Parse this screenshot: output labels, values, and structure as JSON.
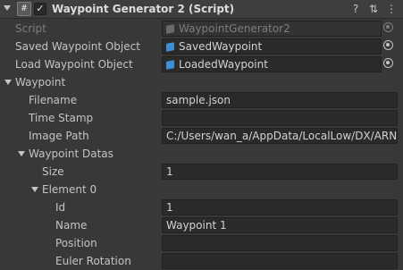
{
  "header": {
    "title": "Waypoint Generator 2 (Script)",
    "script_icon": "#",
    "enabled_mark": "✓",
    "help_icon": "?",
    "preset_icon": "⇅",
    "menu_icon": "⋮"
  },
  "fields": {
    "script": {
      "label": "Script",
      "value": "WaypointGenerator2"
    },
    "saved": {
      "label": "Saved Waypoint Object",
      "value": "SavedWaypoint"
    },
    "load": {
      "label": "Load Waypoint Object",
      "value": "LoadedWaypoint"
    },
    "waypoint": {
      "label": "Waypoint"
    },
    "filename": {
      "label": "Filename",
      "value": "sample.json"
    },
    "timestamp": {
      "label": "Time Stamp",
      "value": ""
    },
    "image_path": {
      "label": "Image Path",
      "value": "C:/Users/wan_a/AppData/LocalLow/DX/ARNav"
    },
    "datas": {
      "label": "Waypoint Datas"
    },
    "size": {
      "label": "Size",
      "value": "1"
    },
    "element0": {
      "label": "Element 0"
    },
    "id": {
      "label": "Id",
      "value": "1"
    },
    "name": {
      "label": "Name",
      "value": "Waypoint 1"
    },
    "position": {
      "label": "Position",
      "value": ""
    },
    "euler": {
      "label": "Euler Rotation",
      "value": ""
    }
  }
}
